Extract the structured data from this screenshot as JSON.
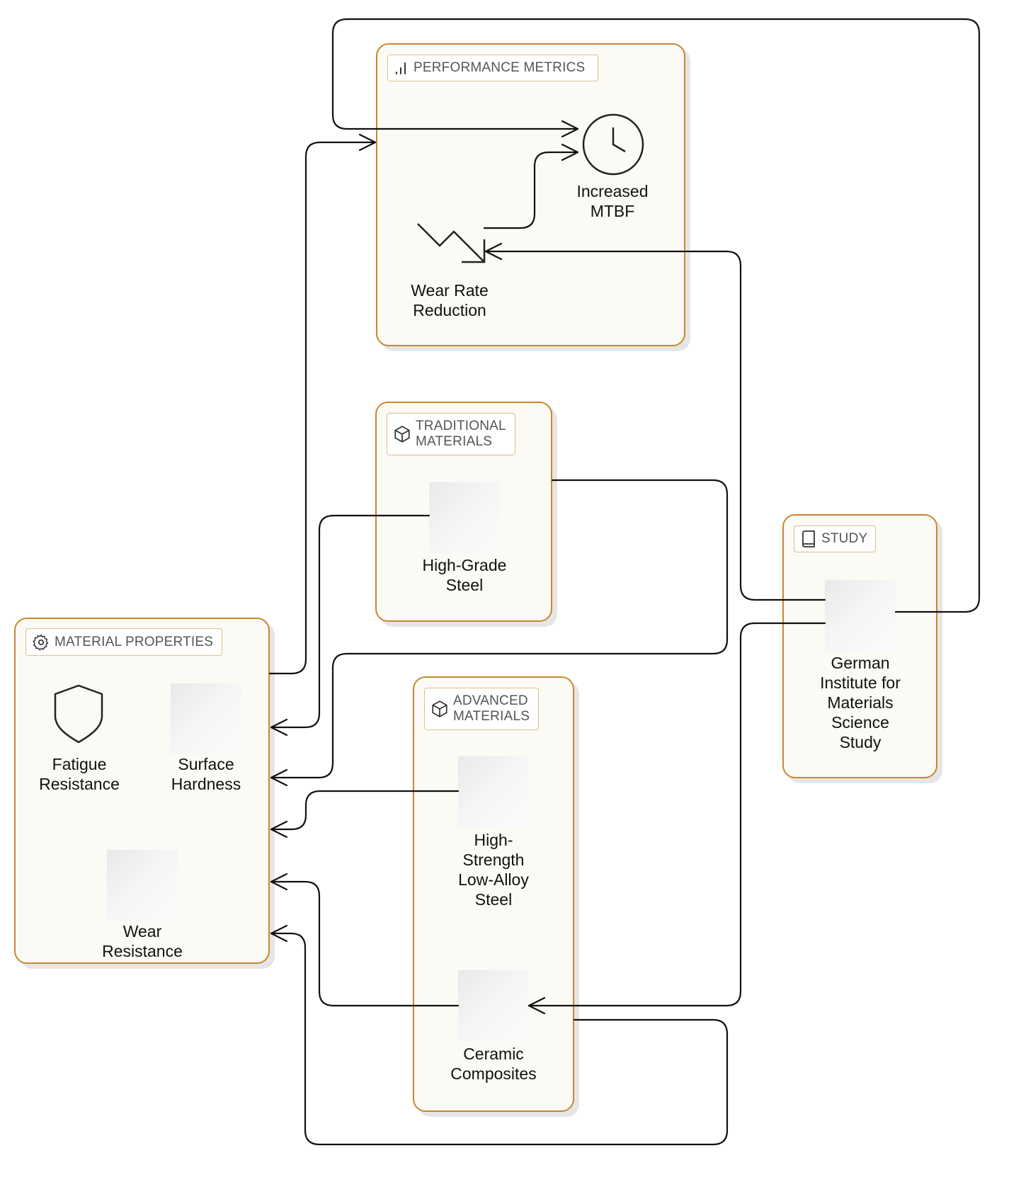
{
  "groups": {
    "performance": {
      "title": "PERFORMANCE METRICS",
      "icon": "bar-chart-icon"
    },
    "traditional": {
      "title": "TRADITIONAL\nMATERIALS",
      "icon": "cube-icon"
    },
    "advanced": {
      "title": "ADVANCED\nMATERIALS",
      "icon": "cube-icon"
    },
    "properties": {
      "title": "MATERIAL PROPERTIES",
      "icon": "gear-icon"
    },
    "study": {
      "title": "STUDY",
      "icon": "book-icon"
    }
  },
  "nodes": {
    "mtbf": {
      "label": "Increased\nMTBF",
      "icon": "clock-icon"
    },
    "wear_rate": {
      "label": "Wear Rate\nReduction",
      "icon": "trending-down-icon"
    },
    "high_grade_steel": {
      "label": "High-Grade\nSteel",
      "icon": "image-placeholder"
    },
    "hsla_steel": {
      "label": "High-\nStrength\nLow-Alloy\nSteel",
      "icon": "image-placeholder"
    },
    "ceramic": {
      "label": "Ceramic\nComposites",
      "icon": "image-placeholder"
    },
    "fatigue": {
      "label": "Fatigue\nResistance",
      "icon": "shield-icon"
    },
    "surface_hardness": {
      "label": "Surface\nHardness",
      "icon": "image-placeholder"
    },
    "wear_resistance": {
      "label": "Wear\nResistance",
      "icon": "image-placeholder"
    },
    "german_institute": {
      "label": "German\nInstitute for\nMaterials\nScience\nStudy",
      "icon": "image-placeholder"
    }
  },
  "edges": [
    {
      "from": "material-properties",
      "to": "performance-metrics"
    },
    {
      "from": "german-institute-study",
      "to": "increased-mtbf"
    },
    {
      "from": "wear-rate-reduction",
      "to": "increased-mtbf"
    },
    {
      "from": "german-institute-study",
      "to": "wear-rate-reduction"
    },
    {
      "from": "high-grade-steel",
      "to": "material-properties"
    },
    {
      "from": "traditional-materials",
      "to": "material-properties"
    },
    {
      "from": "hsla-steel",
      "to": "material-properties"
    },
    {
      "from": "ceramic-composites",
      "to": "material-properties"
    },
    {
      "from": "advanced-materials",
      "to": "material-properties"
    },
    {
      "from": "german-institute-study",
      "to": "ceramic-composites"
    }
  ],
  "colors": {
    "group_border": "#c8872e",
    "group_fill": "#fbfaf5",
    "tag_border": "#dcc08f",
    "edge": "#111111"
  }
}
